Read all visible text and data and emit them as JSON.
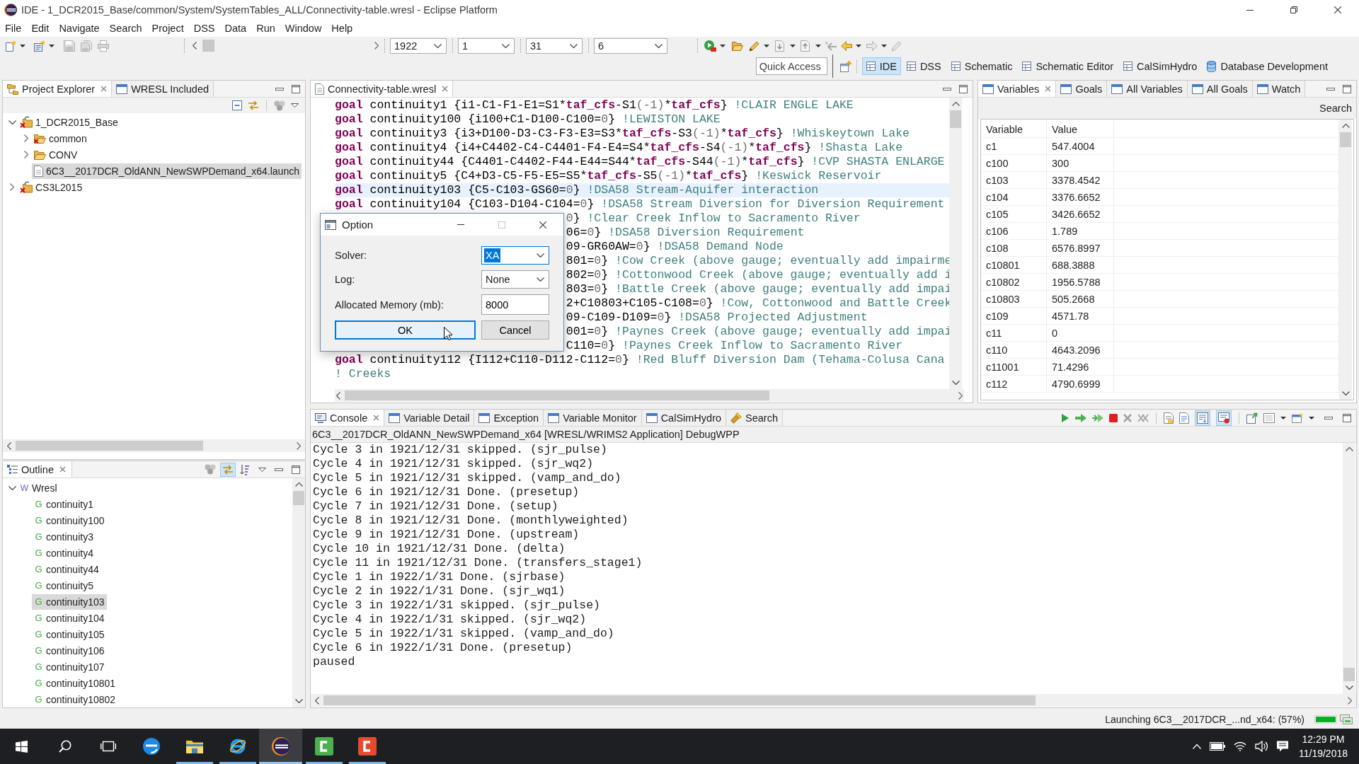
{
  "window": {
    "title": "IDE - 1_DCR2015_Base/common/System/SystemTables_ALL/Connectivity-table.wresl - Eclipse Platform"
  },
  "menu": [
    "File",
    "Edit",
    "Navigate",
    "Search",
    "Project",
    "DSS",
    "Data",
    "Run",
    "Window",
    "Help"
  ],
  "toolbar": {
    "combos": [
      "1922",
      "1",
      "31",
      "6"
    ]
  },
  "quick_access": {
    "placeholder": "Quick Access"
  },
  "perspectives": [
    {
      "label": "IDE",
      "kind": "grid",
      "selected": true
    },
    {
      "label": "DSS",
      "kind": "grid",
      "selected": false
    },
    {
      "label": "Schematic",
      "kind": "grid",
      "selected": false
    },
    {
      "label": "Schematic Editor",
      "kind": "grid",
      "selected": false
    },
    {
      "label": "CalSimHydro",
      "kind": "grid",
      "selected": false
    },
    {
      "label": "Database Development",
      "kind": "database",
      "selected": false
    }
  ],
  "project_explorer": {
    "tabs": [
      {
        "label": "Project Explorer",
        "kind": "explorer",
        "selected": true
      },
      {
        "label": "WRESL Included",
        "kind": "view",
        "selected": false
      }
    ],
    "tree": [
      {
        "label": "1_DCR2015_Base",
        "kind": "project",
        "error": true,
        "expanded": true,
        "selected": false,
        "children": [
          {
            "label": "common",
            "kind": "folder",
            "error": true,
            "expanded": false,
            "selected": false
          },
          {
            "label": "CONV",
            "kind": "folder",
            "error": false,
            "expanded": false,
            "selected": false
          },
          {
            "label": "6C3__2017DCR_OldANN_NewSWPDemand_x64.launch",
            "kind": "file",
            "selected": true
          }
        ]
      },
      {
        "label": "CS3L2015",
        "kind": "project",
        "error": true,
        "expanded": false,
        "selected": false
      }
    ]
  },
  "outline": {
    "tab": {
      "label": "Outline",
      "selected": true
    },
    "tool_toggles": [
      {
        "pressed": true
      }
    ],
    "tree": [
      {
        "label": "Wresl",
        "letter": "W",
        "kind": "module",
        "expanded": true,
        "selected": false,
        "children": [
          {
            "label": "continuity1",
            "letter": "G",
            "kind": "goal",
            "selected": false
          },
          {
            "label": "continuity100",
            "letter": "G",
            "kind": "goal",
            "selected": false
          },
          {
            "label": "continuity3",
            "letter": "G",
            "kind": "goal",
            "selected": false
          },
          {
            "label": "continuity4",
            "letter": "G",
            "kind": "goal",
            "selected": false
          },
          {
            "label": "continuity44",
            "letter": "G",
            "kind": "goal",
            "selected": false
          },
          {
            "label": "continuity5",
            "letter": "G",
            "kind": "goal",
            "selected": false
          },
          {
            "label": "continuity103",
            "letter": "G",
            "kind": "goal",
            "selected": true
          },
          {
            "label": "continuity104",
            "letter": "G",
            "kind": "goal",
            "selected": false
          },
          {
            "label": "continuity105",
            "letter": "G",
            "kind": "goal",
            "selected": false
          },
          {
            "label": "continuity106",
            "letter": "G",
            "kind": "goal",
            "selected": false
          },
          {
            "label": "continuity107",
            "letter": "G",
            "kind": "goal",
            "selected": false
          },
          {
            "label": "continuity10801",
            "letter": "G",
            "kind": "goal",
            "selected": false
          },
          {
            "label": "continuity10802",
            "letter": "G",
            "kind": "goal",
            "selected": false
          }
        ]
      }
    ]
  },
  "editor": {
    "tab": {
      "label": "Connectivity-table.wresl",
      "selected": true
    },
    "lines": [
      {
        "current": false,
        "covered": false,
        "tokens": [
          {
            "kind": "keyword",
            "text": "goal"
          },
          {
            "kind": "plain",
            "text": " continuity1 {i1-C1-F1-E1=S1*"
          },
          {
            "kind": "keyword",
            "text": "taf_cfs"
          },
          {
            "kind": "plain",
            "text": "-S1"
          },
          {
            "kind": "number",
            "text": "(-1)"
          },
          {
            "kind": "plain",
            "text": "*"
          },
          {
            "kind": "keyword",
            "text": "taf_cfs"
          },
          {
            "kind": "plain",
            "text": "} "
          },
          {
            "kind": "comment",
            "text": "!CLAIR ENGLE LAKE"
          }
        ]
      },
      {
        "current": false,
        "covered": false,
        "tokens": [
          {
            "kind": "keyword",
            "text": "goal"
          },
          {
            "kind": "plain",
            "text": " continuity100 {i100+C1-D100-C100="
          },
          {
            "kind": "number",
            "text": "0"
          },
          {
            "kind": "plain",
            "text": "} "
          },
          {
            "kind": "comment",
            "text": "!LEWISTON LAKE"
          }
        ]
      },
      {
        "current": false,
        "covered": false,
        "tokens": [
          {
            "kind": "keyword",
            "text": "goal"
          },
          {
            "kind": "plain",
            "text": " continuity3 {i3+D100-D3-C3-F3-E3=S3*"
          },
          {
            "kind": "keyword",
            "text": "taf_cfs"
          },
          {
            "kind": "plain",
            "text": "-S3"
          },
          {
            "kind": "number",
            "text": "(-1)"
          },
          {
            "kind": "plain",
            "text": "*"
          },
          {
            "kind": "keyword",
            "text": "taf_cfs"
          },
          {
            "kind": "plain",
            "text": "} "
          },
          {
            "kind": "comment",
            "text": "!Whiskeytown Lake"
          }
        ]
      },
      {
        "current": false,
        "covered": false,
        "tokens": [
          {
            "kind": "keyword",
            "text": "goal"
          },
          {
            "kind": "plain",
            "text": " continuity4 {i4+C4402-C4-C4401-F4-E4=S4*"
          },
          {
            "kind": "keyword",
            "text": "taf_cfs"
          },
          {
            "kind": "plain",
            "text": "-S4"
          },
          {
            "kind": "number",
            "text": "(-1)"
          },
          {
            "kind": "plain",
            "text": "*"
          },
          {
            "kind": "keyword",
            "text": "taf_cfs"
          },
          {
            "kind": "plain",
            "text": "} "
          },
          {
            "kind": "comment",
            "text": "!Shasta Lake"
          }
        ]
      },
      {
        "current": false,
        "covered": false,
        "tokens": [
          {
            "kind": "keyword",
            "text": "goal"
          },
          {
            "kind": "plain",
            "text": " continuity44 {C4401-C4402-F44-E44=S44*"
          },
          {
            "kind": "keyword",
            "text": "taf_cfs"
          },
          {
            "kind": "plain",
            "text": "-S44"
          },
          {
            "kind": "number",
            "text": "(-1)"
          },
          {
            "kind": "plain",
            "text": "*"
          },
          {
            "kind": "keyword",
            "text": "taf_cfs"
          },
          {
            "kind": "plain",
            "text": "} "
          },
          {
            "kind": "comment",
            "text": "!CVP SHASTA ENLARGE"
          }
        ]
      },
      {
        "current": false,
        "covered": false,
        "tokens": [
          {
            "kind": "keyword",
            "text": "goal"
          },
          {
            "kind": "plain",
            "text": " continuity5 {C4+D3-C5-F5-E5=S5*"
          },
          {
            "kind": "keyword",
            "text": "taf_cfs"
          },
          {
            "kind": "plain",
            "text": "-S5"
          },
          {
            "kind": "number",
            "text": "(-1)"
          },
          {
            "kind": "plain",
            "text": "*"
          },
          {
            "kind": "keyword",
            "text": "taf_cfs"
          },
          {
            "kind": "plain",
            "text": "} "
          },
          {
            "kind": "comment",
            "text": "!Keswick Reservoir"
          }
        ]
      },
      {
        "current": true,
        "covered": false,
        "tokens": [
          {
            "kind": "keyword",
            "text": "goal"
          },
          {
            "kind": "plain",
            "text": " continuity103 {C5-C103-GS60="
          },
          {
            "kind": "number",
            "text": "0"
          },
          {
            "kind": "plain",
            "text": "} "
          },
          {
            "kind": "comment",
            "text": "!DSA58 Stream-Aquifer interaction"
          }
        ]
      },
      {
        "current": false,
        "covered": false,
        "tokens": [
          {
            "kind": "keyword",
            "text": "goal"
          },
          {
            "kind": "plain",
            "text": " continuity104 {C103-D104-C104="
          },
          {
            "kind": "number",
            "text": "0"
          },
          {
            "kind": "plain",
            "text": "} "
          },
          {
            "kind": "comment",
            "text": "!DSA58 Stream Diversion for Diversion Requirement"
          }
        ]
      },
      {
        "current": false,
        "covered": true,
        "tokens": [
          {
            "kind": "number",
            "text": "0"
          },
          {
            "kind": "plain",
            "text": "} "
          },
          {
            "kind": "comment",
            "text": "!Clear Creek Inflow to Sacramento River"
          }
        ]
      },
      {
        "current": false,
        "covered": true,
        "tokens": [
          {
            "kind": "plain",
            "text": "06="
          },
          {
            "kind": "number",
            "text": "0"
          },
          {
            "kind": "plain",
            "text": "} "
          },
          {
            "kind": "comment",
            "text": "!DSA58 Diversion Requirement"
          }
        ]
      },
      {
        "current": false,
        "covered": true,
        "tokens": [
          {
            "kind": "plain",
            "text": "09-GR60AW="
          },
          {
            "kind": "number",
            "text": "0"
          },
          {
            "kind": "plain",
            "text": "} "
          },
          {
            "kind": "comment",
            "text": "!DSA58 Demand Node"
          }
        ]
      },
      {
        "current": false,
        "covered": true,
        "tokens": [
          {
            "kind": "plain",
            "text": "801="
          },
          {
            "kind": "number",
            "text": "0"
          },
          {
            "kind": "plain",
            "text": "} "
          },
          {
            "kind": "comment",
            "text": "!Cow Creek (above gauge; eventually add impairme"
          }
        ]
      },
      {
        "current": false,
        "covered": true,
        "tokens": [
          {
            "kind": "plain",
            "text": "802="
          },
          {
            "kind": "number",
            "text": "0"
          },
          {
            "kind": "plain",
            "text": "} "
          },
          {
            "kind": "comment",
            "text": "!Cottonwood Creek (above gauge; eventually add i"
          }
        ]
      },
      {
        "current": false,
        "covered": true,
        "tokens": [
          {
            "kind": "plain",
            "text": "803="
          },
          {
            "kind": "number",
            "text": "0"
          },
          {
            "kind": "plain",
            "text": "} "
          },
          {
            "kind": "comment",
            "text": "!Battle Creek (above gauge; eventually add impai"
          }
        ]
      },
      {
        "current": false,
        "covered": true,
        "tokens": [
          {
            "kind": "plain",
            "text": "2+C10803+C105-C108="
          },
          {
            "kind": "number",
            "text": "0"
          },
          {
            "kind": "plain",
            "text": "} "
          },
          {
            "kind": "comment",
            "text": "!Cow, Cottonwood and Battle Creek"
          }
        ]
      },
      {
        "current": false,
        "covered": true,
        "tokens": [
          {
            "kind": "plain",
            "text": "09-C109-D109="
          },
          {
            "kind": "number",
            "text": "0"
          },
          {
            "kind": "plain",
            "text": "} "
          },
          {
            "kind": "comment",
            "text": "!DSA58 Projected Adjustment"
          }
        ]
      },
      {
        "current": false,
        "covered": true,
        "tokens": [
          {
            "kind": "plain",
            "text": "001="
          },
          {
            "kind": "number",
            "text": "0"
          },
          {
            "kind": "plain",
            "text": "} "
          },
          {
            "kind": "comment",
            "text": "!Paynes Creek (above gauge; eventually add impai"
          }
        ]
      },
      {
        "current": false,
        "covered": true,
        "tokens": [
          {
            "kind": "plain",
            "text": "C110="
          },
          {
            "kind": "number",
            "text": "0"
          },
          {
            "kind": "plain",
            "text": "} "
          },
          {
            "kind": "comment",
            "text": "!Paynes Creek Inflow to Sacramento River"
          }
        ]
      },
      {
        "current": false,
        "covered": false,
        "tokens": [
          {
            "kind": "keyword",
            "text": "goal"
          },
          {
            "kind": "plain",
            "text": " continuity112 {I112+C110-D112-C112="
          },
          {
            "kind": "number",
            "text": "0"
          },
          {
            "kind": "plain",
            "text": "} "
          },
          {
            "kind": "comment",
            "text": "!Red Bluff Diversion Dam (Tehama-Colusa Cana"
          }
        ]
      },
      {
        "current": false,
        "covered": false,
        "tokens": [
          {
            "kind": "comment",
            "text": "! Creeks"
          }
        ]
      }
    ]
  },
  "variables": {
    "tabs": [
      {
        "label": "Variables",
        "selected": true
      },
      {
        "label": "Goals",
        "selected": false
      },
      {
        "label": "All Variables",
        "selected": false
      },
      {
        "label": "All Goals",
        "selected": false
      },
      {
        "label": "Watch",
        "selected": false
      }
    ],
    "search_label": "Search",
    "table": {
      "columns": [
        "Variable",
        "Value"
      ],
      "rows": [
        [
          "c1",
          "547.4004"
        ],
        [
          "c100",
          "300"
        ],
        [
          "c103",
          "3378.4542"
        ],
        [
          "c104",
          "3376.6652"
        ],
        [
          "c105",
          "3426.6652"
        ],
        [
          "c106",
          "1.789"
        ],
        [
          "c108",
          "6576.8997"
        ],
        [
          "c10801",
          "688.3888"
        ],
        [
          "c10802",
          "1956.5788"
        ],
        [
          "c10803",
          "505.2668"
        ],
        [
          "c109",
          "4571.78"
        ],
        [
          "c11",
          "0"
        ],
        [
          "c110",
          "4643.2096"
        ],
        [
          "c11001",
          "71.4296"
        ],
        [
          "c112",
          "4790.6999"
        ]
      ]
    }
  },
  "console": {
    "tabs": [
      {
        "label": "Console",
        "kind": "console",
        "selected": true
      },
      {
        "label": "Variable Detail",
        "kind": "view",
        "selected": false
      },
      {
        "label": "Exception",
        "kind": "view",
        "selected": false
      },
      {
        "label": "Variable Monitor",
        "kind": "view",
        "selected": false
      },
      {
        "label": "CalSimHydro",
        "kind": "view",
        "selected": false
      },
      {
        "label": "Search",
        "kind": "search",
        "selected": false
      }
    ],
    "tool_toggles": [
      {
        "pressed": true
      },
      {
        "pressed": true
      }
    ],
    "process": "6C3__2017DCR_OldANN_NewSWPDemand_x64 [WRESL/WRIMS2 Application] DebugWPP",
    "lines": [
      "Cycle 3 in 1921/12/31 skipped. (sjr_pulse)",
      "Cycle 4 in 1921/12/31 skipped. (sjr_wq2)",
      "Cycle 5 in 1921/12/31 skipped. (vamp_and_do)",
      "Cycle 6 in 1921/12/31 Done. (presetup)",
      "Cycle 7 in 1921/12/31 Done. (setup)",
      "Cycle 8 in 1921/12/31 Done. (monthlyweighted)",
      "Cycle 9 in 1921/12/31 Done. (upstream)",
      "Cycle 10 in 1921/12/31 Done. (delta)",
      "Cycle 11 in 1921/12/31 Done. (transfers_stage1)",
      "Cycle 1 in 1922/1/31 Done. (sjrbase)",
      "Cycle 2 in 1922/1/31 Done. (sjr_wq1)",
      "Cycle 3 in 1922/1/31 skipped. (sjr_pulse)",
      "Cycle 4 in 1922/1/31 skipped. (sjr_wq2)",
      "Cycle 5 in 1922/1/31 skipped. (vamp_and_do)",
      "Cycle 6 in 1922/1/31 Done. (presetup)",
      "paused"
    ]
  },
  "dialog": {
    "title": "Option",
    "fields": [
      {
        "label": "Solver:",
        "kind": "combo",
        "value": "XA",
        "focused": true
      },
      {
        "label": "Log:",
        "kind": "combo",
        "value": "None",
        "focused": false
      },
      {
        "label": "Allocated Memory (mb):",
        "kind": "input",
        "value": "8000",
        "focused": false
      }
    ],
    "buttons": [
      {
        "label": "OK",
        "default": true
      },
      {
        "label": "Cancel",
        "default": false
      }
    ]
  },
  "status_bar": {
    "text": "Launching 6C3__2017DCR_...nd_x64: (57%)",
    "level": 1
  },
  "taskbar": {
    "apps": [
      {
        "kind": "browser",
        "running": false,
        "selected": false
      },
      {
        "kind": "files",
        "running": true,
        "selected": false
      },
      {
        "kind": "web_browser",
        "running": true,
        "selected": false
      },
      {
        "kind": "ide",
        "running": true,
        "selected": true
      },
      {
        "kind": "video_editor",
        "running": true,
        "selected": false
      },
      {
        "kind": "recorder",
        "running": true,
        "selected": false
      }
    ],
    "clock": {
      "time": "12:29 PM",
      "date": "11/19/2018"
    }
  }
}
